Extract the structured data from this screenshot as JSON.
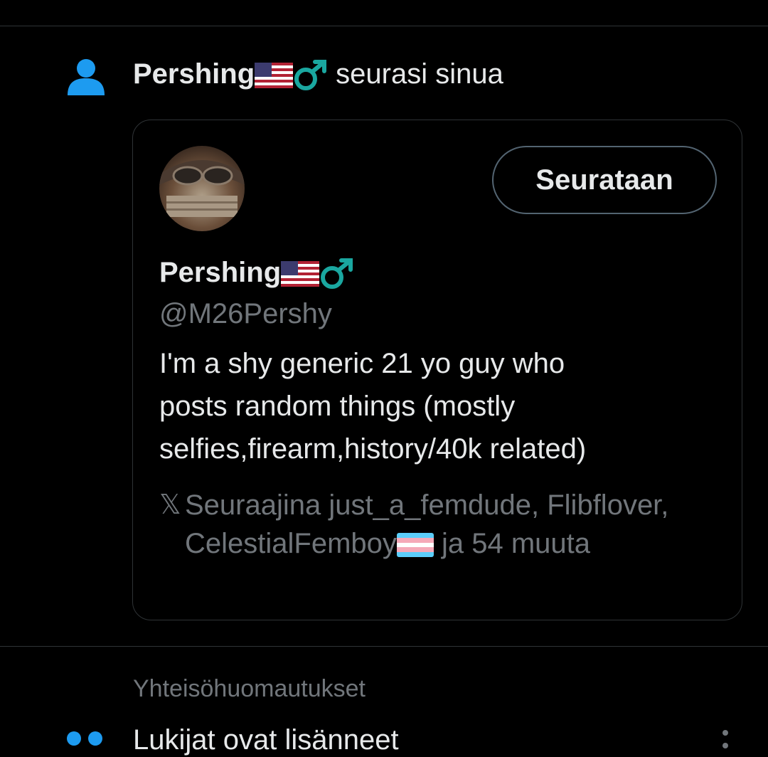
{
  "notification": {
    "icon": "person-icon",
    "user_name": "Pershing",
    "action_text": "seurasi sinua"
  },
  "profile_card": {
    "follow_button_label": "Seurataan",
    "display_name": "Pershing",
    "handle": "@M26Pershy",
    "bio": "I'm a shy generic 21 yo guy who\nposts random things (mostly\nselfies,firearm,history/40k related)",
    "followed_by_text_1": "Seuraajina just_a_femdude, Flibflover, CelestialFemboy",
    "followed_by_text_2": " ja 54 muuta"
  },
  "section": {
    "label": "Yhteisöhuomautukset"
  },
  "community_note": {
    "icon": "people-icon",
    "text": "Lukijat ovat lisänneet"
  },
  "colors": {
    "accent": "#1d9bf0",
    "secondary_text": "#71767b",
    "male_sign": "#1aa7a0"
  }
}
